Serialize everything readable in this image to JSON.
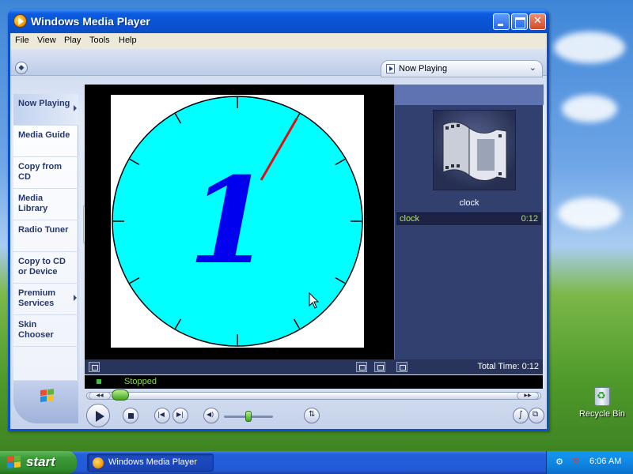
{
  "window": {
    "title": "Windows Media Player",
    "menu": [
      "File",
      "View",
      "Play",
      "Tools",
      "Help"
    ]
  },
  "view_selector": {
    "label": "Now Playing"
  },
  "nav": {
    "items": [
      {
        "label": "Now Playing",
        "active": true,
        "has_arrow": true
      },
      {
        "label": "Media Guide",
        "active": false,
        "has_arrow": false
      },
      {
        "label": "Copy from CD",
        "active": false,
        "has_arrow": false
      },
      {
        "label": "Media Library",
        "active": false,
        "has_arrow": false
      },
      {
        "label": "Radio Tuner",
        "active": false,
        "has_arrow": false
      },
      {
        "label": "Copy to CD or Device",
        "active": false,
        "has_arrow": false
      },
      {
        "label": "Premium Services",
        "active": false,
        "has_arrow": true
      },
      {
        "label": "Skin Chooser",
        "active": false,
        "has_arrow": false
      }
    ]
  },
  "video": {
    "clock": {
      "face_color": "#00ffff",
      "numeral": "1",
      "numeral_color": "#0000ee",
      "hand_color": "#dd1111",
      "hand_position_seconds": 5
    }
  },
  "playlist": {
    "album_caption": "clock",
    "items": [
      {
        "title": "clock",
        "duration": "0:12"
      }
    ]
  },
  "video_toolbar": {
    "total_time": "Total Time: 0:12"
  },
  "status": {
    "text": "Stopped"
  },
  "playback": {
    "seek_position": 0.05,
    "volume": 0.5
  },
  "desktop": {
    "icons": [
      {
        "label": "Recycle Bin",
        "icon": "recycle-bin-icon"
      }
    ]
  },
  "taskbar": {
    "start_label": "start",
    "tasks": [
      {
        "label": "Windows Media Player"
      }
    ],
    "clock": "6:06 AM"
  },
  "colors": {
    "title_bar": "#0a52d2",
    "accent_green": "#3ca51e",
    "playlist_bg": "#32406f",
    "status_text": "#8bd946"
  }
}
